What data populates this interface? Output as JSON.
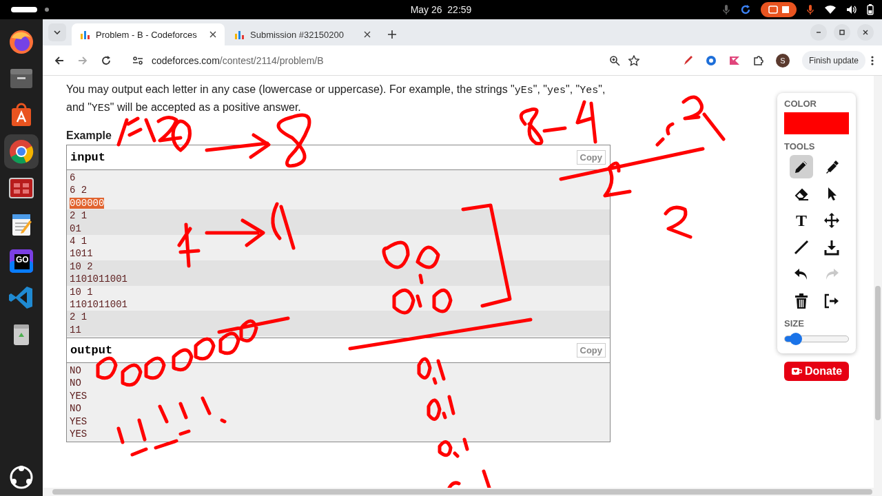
{
  "top_bar": {
    "date": "May 26",
    "time": "22:59"
  },
  "dock": {
    "items": [
      {
        "kind": "firefox",
        "selected": false
      },
      {
        "kind": "files",
        "selected": false
      },
      {
        "kind": "appcenter",
        "selected": false
      },
      {
        "kind": "chrome",
        "selected": true
      },
      {
        "kind": "redapp",
        "selected": false
      },
      {
        "kind": "editor",
        "selected": false
      },
      {
        "kind": "goland",
        "selected": false,
        "label": "GO"
      },
      {
        "kind": "vscode",
        "selected": false
      },
      {
        "kind": "trash",
        "selected": false
      }
    ]
  },
  "browser": {
    "tabs": [
      {
        "title": "Problem - B - Codeforces",
        "selected": true
      },
      {
        "title": "Submission #32150200",
        "selected": false
      }
    ],
    "address": {
      "host": "codeforces.com",
      "path": "/contest/2114/problem/B"
    },
    "profile": "S",
    "update_button": "Finish update"
  },
  "page": {
    "paragraph": [
      {
        "kind": "text",
        "text": "You may output each letter in any case (lowercase or uppercase). For example, the strings \""
      },
      {
        "kind": "code",
        "text": "yEs"
      },
      {
        "kind": "text",
        "text": "\", \""
      },
      {
        "kind": "code",
        "text": "yes"
      },
      {
        "kind": "text",
        "text": "\", \""
      },
      {
        "kind": "code",
        "text": "Yes"
      },
      {
        "kind": "text",
        "text": "\", and \""
      },
      {
        "kind": "code",
        "text": "YES"
      },
      {
        "kind": "text",
        "text": "\" will be accepted as a positive answer."
      }
    ],
    "example_heading": "Example",
    "input": {
      "title": "input",
      "copy": "Copy",
      "lines": [
        {
          "text": "6",
          "shaded": false,
          "selected": false
        },
        {
          "text": "6 2",
          "shaded": false,
          "selected": false
        },
        {
          "text": "000000",
          "shaded": false,
          "selected": true
        },
        {
          "text": "2 1",
          "shaded": true,
          "selected": false
        },
        {
          "text": "01",
          "shaded": true,
          "selected": false
        },
        {
          "text": "4 1",
          "shaded": false,
          "selected": false
        },
        {
          "text": "1011",
          "shaded": false,
          "selected": false
        },
        {
          "text": "10 2",
          "shaded": true,
          "selected": false
        },
        {
          "text": "1101011001",
          "shaded": true,
          "selected": false
        },
        {
          "text": "10 1",
          "shaded": false,
          "selected": false
        },
        {
          "text": "1101011001",
          "shaded": false,
          "selected": false
        },
        {
          "text": "2 1",
          "shaded": true,
          "selected": false
        },
        {
          "text": "11",
          "shaded": true,
          "selected": false
        }
      ]
    },
    "output": {
      "title": "output",
      "copy": "Copy",
      "lines": [
        "NO",
        "NO",
        "YES",
        "NO",
        "YES",
        "YES"
      ]
    }
  },
  "draw_panel": {
    "color_label": "COLOR",
    "color": "#ff0000",
    "tools_label": "TOOLS",
    "tools": [
      {
        "kind": "pencil",
        "selected": true,
        "disabled": false
      },
      {
        "kind": "marker",
        "selected": false,
        "disabled": false
      },
      {
        "kind": "eraser",
        "selected": false,
        "disabled": false
      },
      {
        "kind": "pointer",
        "selected": false,
        "disabled": false
      },
      {
        "kind": "text",
        "selected": false,
        "disabled": false,
        "label": "T"
      },
      {
        "kind": "move",
        "selected": false,
        "disabled": false
      },
      {
        "kind": "line",
        "selected": false,
        "disabled": false
      },
      {
        "kind": "download",
        "selected": false,
        "disabled": false
      },
      {
        "kind": "undo",
        "selected": false,
        "disabled": false
      },
      {
        "kind": "redo",
        "selected": false,
        "disabled": true
      },
      {
        "kind": "trash",
        "selected": false,
        "disabled": false
      },
      {
        "kind": "exit",
        "selected": false,
        "disabled": false
      }
    ],
    "size_label": "SIZE",
    "size": {
      "level": 0.1
    },
    "donate": "Donate"
  }
}
